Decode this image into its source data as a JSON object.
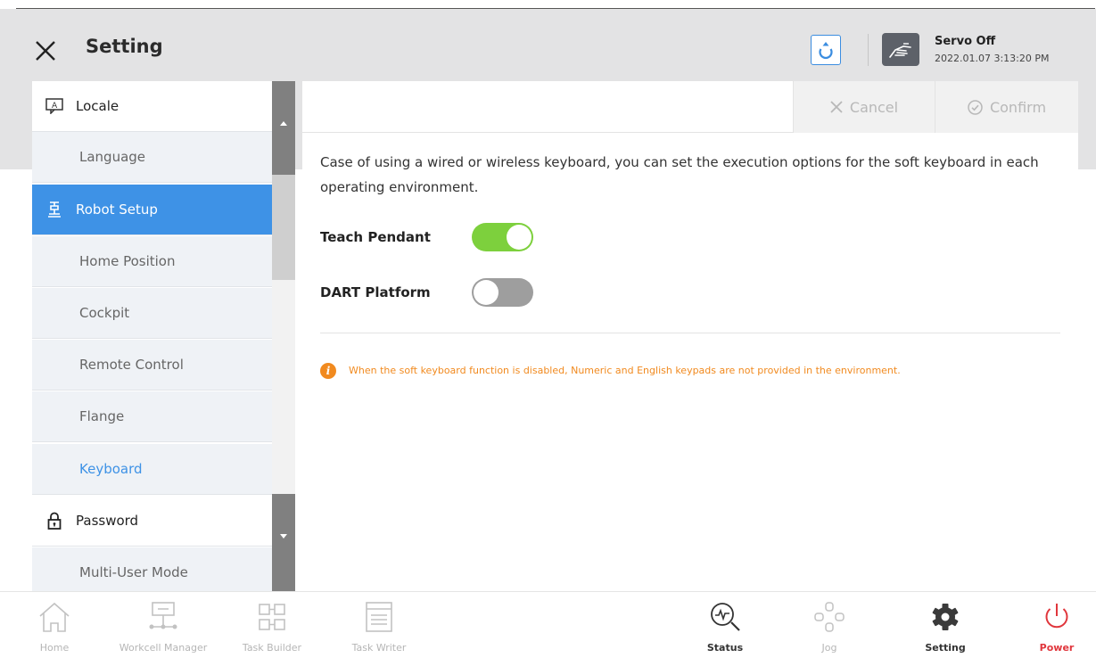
{
  "header": {
    "title": "Setting",
    "servo_status": "Servo Off",
    "datetime": "2022.01.07 3:13:20 PM"
  },
  "sidebar": {
    "items": [
      {
        "label": "Locale",
        "type": "category",
        "icon": "locale-icon"
      },
      {
        "label": "Language",
        "type": "sub"
      },
      {
        "label": "Robot Setup",
        "type": "category",
        "icon": "robot-icon",
        "active": true
      },
      {
        "label": "Home Position",
        "type": "sub"
      },
      {
        "label": "Cockpit",
        "type": "sub"
      },
      {
        "label": "Remote Control",
        "type": "sub"
      },
      {
        "label": "Flange",
        "type": "sub"
      },
      {
        "label": "Keyboard",
        "type": "sub",
        "selected": true
      },
      {
        "label": "Password",
        "type": "category",
        "icon": "lock-icon"
      },
      {
        "label": "Multi-User Mode",
        "type": "sub"
      }
    ]
  },
  "panel": {
    "cancel_label": "Cancel",
    "confirm_label": "Confirm",
    "description": "Case of using a wired or wireless keyboard, you can set the execution options for the soft keyboard in each operating environment.",
    "options": [
      {
        "label": "Teach Pendant",
        "enabled": true
      },
      {
        "label": "DART Platform",
        "enabled": false
      }
    ],
    "info": "When the soft keyboard function is disabled, Numeric and English keypads are not provided in the environment."
  },
  "bottom_nav": [
    {
      "label": "Home",
      "icon": "home-icon"
    },
    {
      "label": "Workcell Manager",
      "icon": "workcell-icon"
    },
    {
      "label": "Task Builder",
      "icon": "task-builder-icon"
    },
    {
      "label": "Task Writer",
      "icon": "task-writer-icon"
    },
    {
      "label": "Status",
      "icon": "status-icon"
    },
    {
      "label": "Jog",
      "icon": "jog-icon"
    },
    {
      "label": "Setting",
      "icon": "gear-icon"
    },
    {
      "label": "Power",
      "icon": "power-icon"
    }
  ],
  "colors": {
    "accent": "#3e92e6",
    "toggle_on": "#7dd03d",
    "toggle_off": "#9e9e9e",
    "warning": "#f18a1f",
    "power": "#e0363c"
  }
}
